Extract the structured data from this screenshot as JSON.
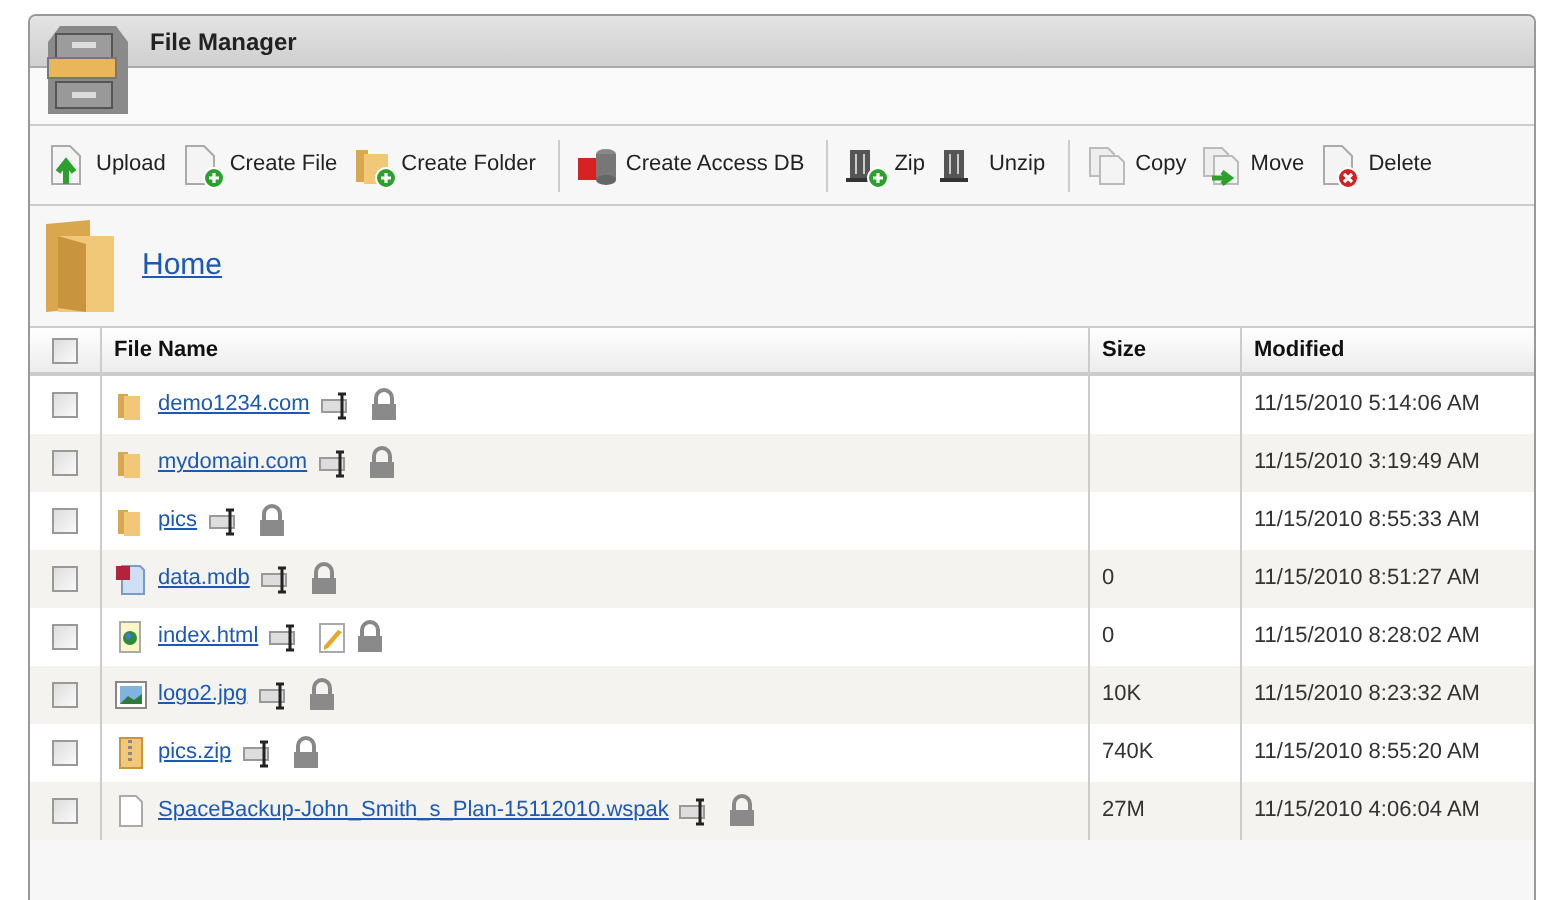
{
  "window": {
    "title": "File Manager"
  },
  "toolbar": [
    [
      {
        "label": "Upload",
        "kind": "upload"
      },
      {
        "label": "Create File",
        "kind": "newfile"
      },
      {
        "label": "Create Folder",
        "kind": "newfolder"
      }
    ],
    [
      {
        "label": "Create Access DB",
        "kind": "db"
      }
    ],
    [
      {
        "label": "Zip",
        "kind": "zip"
      },
      {
        "label": "Unzip",
        "kind": "unzip"
      }
    ],
    [
      {
        "label": "Copy",
        "kind": "copy"
      },
      {
        "label": "Move",
        "kind": "move"
      },
      {
        "label": "Delete",
        "kind": "delete"
      }
    ]
  ],
  "breadcrumb": {
    "label": "Home"
  },
  "table": {
    "columns": [
      "File Name",
      "Size",
      "Modified"
    ],
    "header_checked": false,
    "rows": [
      {
        "name": "demo1234.com",
        "kind": "folder",
        "size": "",
        "modified": "11/15/2010 5:14:06 AM",
        "checked": false,
        "editable": false
      },
      {
        "name": "mydomain.com",
        "kind": "folder",
        "size": "",
        "modified": "11/15/2010 3:19:49 AM",
        "checked": false,
        "editable": false
      },
      {
        "name": "pics",
        "kind": "folder",
        "size": "",
        "modified": "11/15/2010 8:55:33 AM",
        "checked": false,
        "editable": false
      },
      {
        "name": "data.mdb",
        "kind": "mdb",
        "size": "0",
        "modified": "11/15/2010 8:51:27 AM",
        "checked": false,
        "editable": false
      },
      {
        "name": "index.html",
        "kind": "html",
        "size": "0",
        "modified": "11/15/2010 8:28:02 AM",
        "checked": false,
        "editable": true
      },
      {
        "name": "logo2.jpg",
        "kind": "image",
        "size": "10K",
        "modified": "11/15/2010 8:23:32 AM",
        "checked": false,
        "editable": false
      },
      {
        "name": "pics.zip",
        "kind": "zip",
        "size": "740K",
        "modified": "11/15/2010 8:55:20 AM",
        "checked": false,
        "editable": false
      },
      {
        "name": "SpaceBackup-John_Smith_s_Plan-15112010.wspak",
        "kind": "file",
        "size": "27M",
        "modified": "11/15/2010 4:06:04 AM",
        "checked": false,
        "editable": false
      }
    ]
  }
}
